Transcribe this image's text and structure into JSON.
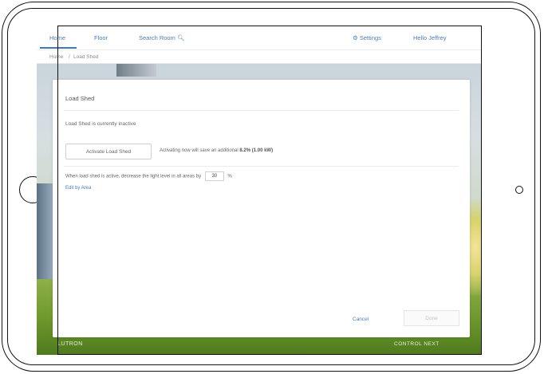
{
  "nav": {
    "home": "Home",
    "floor": "Floor",
    "search": "Search Room",
    "settings": "Settings",
    "greeting": "Hello Jeffrey"
  },
  "breadcrumb": {
    "home": "Home",
    "current": "Load Shed"
  },
  "card": {
    "title": "Load Shed",
    "status": "Load Shed is currently inactive",
    "activate_button": "Activate Load Shed",
    "activate_info_prefix": "Activating now will save an additional",
    "activate_info_value": "8.2% (1.00 kW)",
    "decrease_prefix": "When load shed is active, decrease the light level in all areas by",
    "decrease_value": "30",
    "decrease_suffix": "%",
    "edit_link": "Edit by Area",
    "cancel": "Cancel",
    "done": "Done"
  },
  "footer": {
    "brand_left": "LUTRON",
    "brand_right": "CONTROL NEXT"
  },
  "icons": {
    "search": "search-icon",
    "settings": "gear-icon"
  },
  "colors": {
    "accent": "#4a7fb8",
    "nav_underline": "#3f78b8"
  }
}
